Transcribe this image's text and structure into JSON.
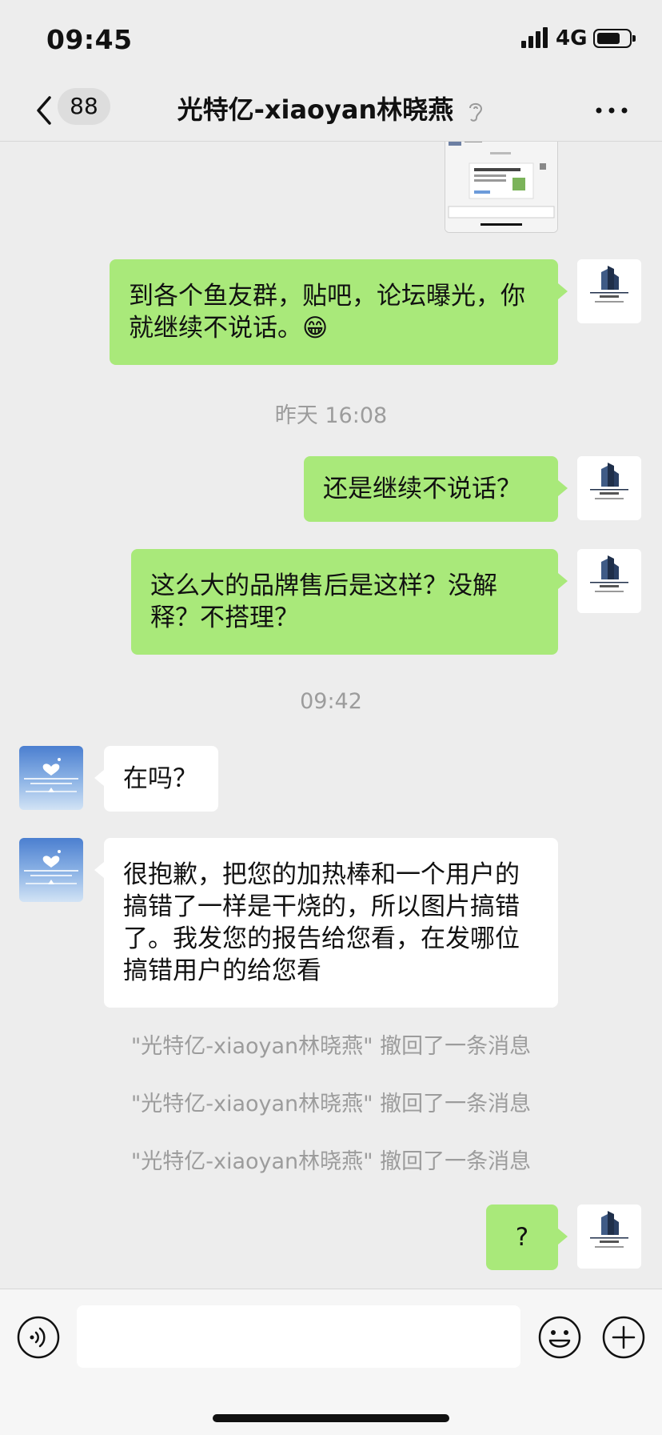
{
  "status_bar": {
    "time": "09:45",
    "network": "4G"
  },
  "header": {
    "badge_count": "88",
    "title": "光特亿-xiaoyan林晓燕"
  },
  "messages": [
    {
      "sender": "me",
      "text": "到各个鱼友群，贴吧，论坛曝光，你就继续不说话。😁"
    },
    {
      "type": "time",
      "text": "昨天 16:08"
    },
    {
      "sender": "me",
      "text": "还是继续不说话？"
    },
    {
      "sender": "me",
      "text": "这么大的品牌售后是这样？没解释？不搭理？"
    },
    {
      "type": "time",
      "text": "09:42"
    },
    {
      "sender": "them",
      "text": "在吗？"
    },
    {
      "sender": "them",
      "text": "很抱歉，把您的加热棒和一个用户的搞错了一样是干烧的，所以图片搞错了。我发您的报告给您看，在发哪位搞错用户的给您看"
    },
    {
      "type": "recall",
      "text": "\"光特亿-xiaoyan林晓燕\" 撤回了一条消息"
    },
    {
      "type": "recall",
      "text": "\"光特亿-xiaoyan林晓燕\" 撤回了一条消息"
    },
    {
      "type": "recall",
      "text": "\"光特亿-xiaoyan林晓燕\" 撤回了一条消息"
    },
    {
      "sender": "me",
      "text": "?"
    }
  ],
  "input": {
    "value": "",
    "placeholder": ""
  },
  "icons": {
    "back": "chevron-left-icon",
    "mute": "ear-icon",
    "more": "more-icon",
    "voice": "voice-icon",
    "emoji": "emoji-icon",
    "plus": "plus-icon"
  },
  "colors": {
    "background": "#EDEDED",
    "my_bubble": "#A9E97A",
    "their_bubble": "#FFFFFF",
    "system_text": "#9C9C9C"
  }
}
